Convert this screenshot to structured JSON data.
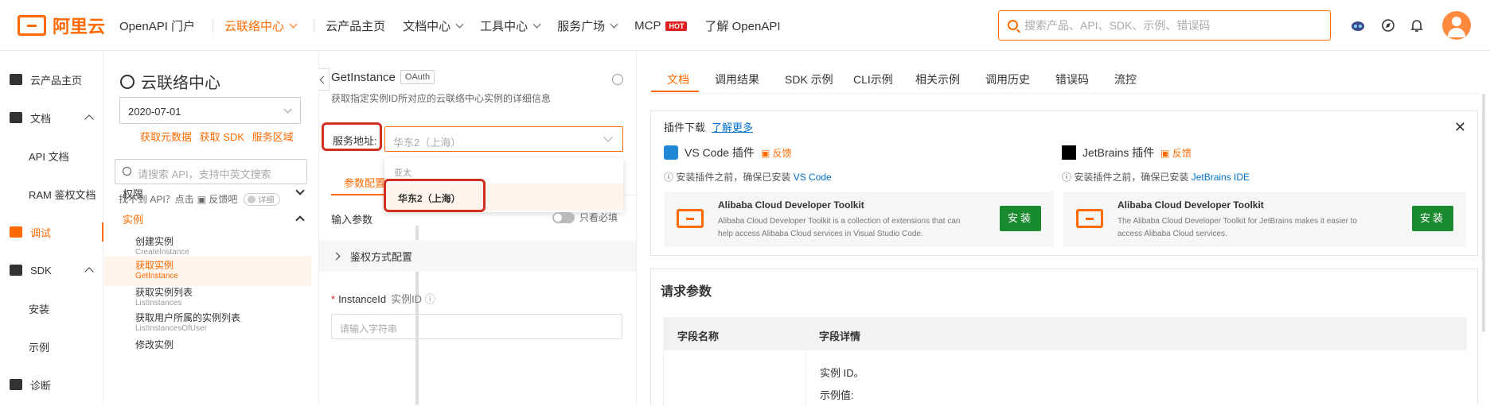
{
  "header": {
    "logo_text": "阿里云",
    "nav": [
      {
        "label": "OpenAPI 门户"
      },
      {
        "label": "云联络中心"
      },
      {
        "label": "云产品主页"
      },
      {
        "label": "文档中心"
      },
      {
        "label": "工具中心"
      },
      {
        "label": "服务广场"
      },
      {
        "label": "MCP"
      },
      {
        "label": "了解 OpenAPI"
      }
    ],
    "hot_badge": "HOT",
    "search_placeholder": "搜索产品、API、SDK、示例、错误码",
    "accent_color": "#ff6a00"
  },
  "leftnav": {
    "items": [
      {
        "label": "云产品主页",
        "icon": "home-icon"
      },
      {
        "label": "文档",
        "icon": "doc-icon"
      },
      {
        "label": "API 文档"
      },
      {
        "label": "RAM 鉴权文档"
      },
      {
        "label": "调试",
        "icon": "debug-icon"
      },
      {
        "label": "SDK",
        "icon": "sdk-icon"
      },
      {
        "label": "安装"
      },
      {
        "label": "示例"
      },
      {
        "label": "诊断",
        "icon": "diagnose-icon"
      }
    ]
  },
  "catalog": {
    "title": "云联络中心",
    "version": "2020-07-01",
    "links": [
      "获取元数据",
      "获取 SDK",
      "服务区域"
    ],
    "search_placeholder": "请搜索 API，支持中英文搜索",
    "not_found": "找不到 API？点击",
    "feedback": "反馈吧",
    "detail_toggle": "详细",
    "groups": [
      {
        "label": "权限"
      },
      {
        "label": "实例"
      }
    ],
    "items": [
      {
        "cn": "创建实例",
        "en": "CreateInstance"
      },
      {
        "cn": "获取实例",
        "en": "GetInstance"
      },
      {
        "cn": "获取实例列表",
        "en": "ListInstances"
      },
      {
        "cn": "获取用户所属的实例列表",
        "en": "ListInstancesOfUser"
      },
      {
        "cn": "修改实例",
        "en": ""
      }
    ]
  },
  "api": {
    "name": "GetInstance",
    "auth": "OAuth",
    "desc": "获取指定实例ID所对应的云联络中心实例的详细信息",
    "service_label": "服务地址:",
    "service_placeholder": "华东2（上海）",
    "tab": "参数配置",
    "dropdown_group": "亚太",
    "dropdown_option": "华东2（上海）",
    "input_params": "输入参数",
    "required_only": "只看必填",
    "auth_config": "鉴权方式配置",
    "field_name": "InstanceId",
    "field_cn": "实例ID",
    "field_placeholder": "请输入字符串"
  },
  "right": {
    "tabs": [
      "文档",
      "调用结果",
      "SDK 示例",
      "CLI示例",
      "相关示例",
      "调用历史",
      "错误码",
      "流控"
    ],
    "plugin_title": "插件下载",
    "learn_more": "了解更多",
    "vscode_name": "VS Code 插件",
    "jetbrains_name": "JetBrains 插件",
    "feedback": "反馈",
    "note_prefix": "安装插件之前，确保已安装",
    "vscode": "VS Code",
    "jetbrains_ide": "JetBrains IDE",
    "toolkit_title": "Alibaba Cloud Developer Toolkit",
    "vscode_desc": "Alibaba Cloud Developer Toolkit is a collection of extensions that can help access Alibaba Cloud services in Visual Studio Code.",
    "jetbrains_desc": "The Alibaba Cloud Developer Toolkit for JetBrains makes it easier to access Alibaba Cloud services.",
    "install": "安装",
    "req_title": "请求参数",
    "col_name": "字段名称",
    "col_detail": "字段详情",
    "row_desc": "实例 ID。",
    "row_example": "示例值:"
  }
}
